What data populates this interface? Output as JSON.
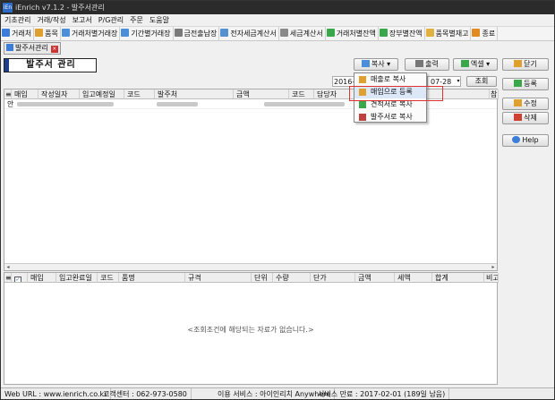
{
  "window": {
    "title": "iEnrich v7.1.2 - 발주서관리",
    "logo_text": "iEn"
  },
  "menubar": [
    "기초관리",
    "거래/작성",
    "보고서",
    "P/G관리",
    "주문",
    "도움말"
  ],
  "toolbar": [
    {
      "label": "거래처",
      "icon": "people-icon",
      "color": "#3b7dd8"
    },
    {
      "label": "품목",
      "icon": "box-icon",
      "color": "#e0a030"
    },
    {
      "label": "거래처별거래장",
      "icon": "ledger-icon",
      "color": "#4a8fd8"
    },
    {
      "label": "기간별거래장",
      "icon": "ledger-icon",
      "color": "#4a8fd8"
    },
    {
      "label": "금전출납장",
      "icon": "cashbook-icon",
      "color": "#7a7a7a"
    },
    {
      "label": "전자세금계산서",
      "icon": "e-invoice-icon",
      "color": "#5590d0"
    },
    {
      "label": "세금계산서",
      "icon": "invoice-icon",
      "color": "#8a8a8a"
    },
    {
      "label": "거래처별잔액",
      "icon": "balance-icon",
      "color": "#3aa84a"
    },
    {
      "label": "장부별잔액",
      "icon": "balance-icon",
      "color": "#3aa84a"
    },
    {
      "label": "품목별재고",
      "icon": "stock-icon",
      "color": "#e0b040"
    },
    {
      "label": "종료",
      "icon": "exit-icon",
      "color": "#e08a20"
    }
  ],
  "doc_tab": {
    "label": "발주서관리"
  },
  "page_title": "발주서 관리",
  "actions": {
    "copy": "복사",
    "print": "출력",
    "excel": "엑셀",
    "close": "닫기",
    "register": "등록",
    "edit": "수정",
    "delete": "삭제",
    "help": "Help",
    "search": "조회"
  },
  "date_filter": {
    "from": "2016-0",
    "to": "07-28"
  },
  "copy_menu": [
    "매출로 복사",
    "매입으로 등록",
    "견적서로 복사",
    "발주서로 복사"
  ],
  "top_grid": {
    "columns": [
      "매입",
      "작성일자",
      "입고예정일",
      "코드",
      "발주처",
      "금액",
      "코드",
      "담당자",
      "참"
    ],
    "first_row_prefix": "안"
  },
  "bottom_grid": {
    "columns": [
      "매입",
      "입고완료일",
      "코드",
      "품명",
      "규격",
      "단위",
      "수량",
      "단가",
      "금액",
      "세액",
      "합계",
      "비고"
    ],
    "empty_message": "<조회조건에 해당되는 자료가 없습니다.>"
  },
  "status": {
    "web_url": "Web URL : www.ienrich.co.kr",
    "center": "고객센터 : 062-973-0580",
    "service": "이용 서비스 : 아이인리치 Anywhere",
    "expiry": "서비스 만료 : 2017-02-01 (189일 남음)"
  },
  "colors": {
    "accent": "#1f3d8c",
    "highlight": "#e03030"
  }
}
